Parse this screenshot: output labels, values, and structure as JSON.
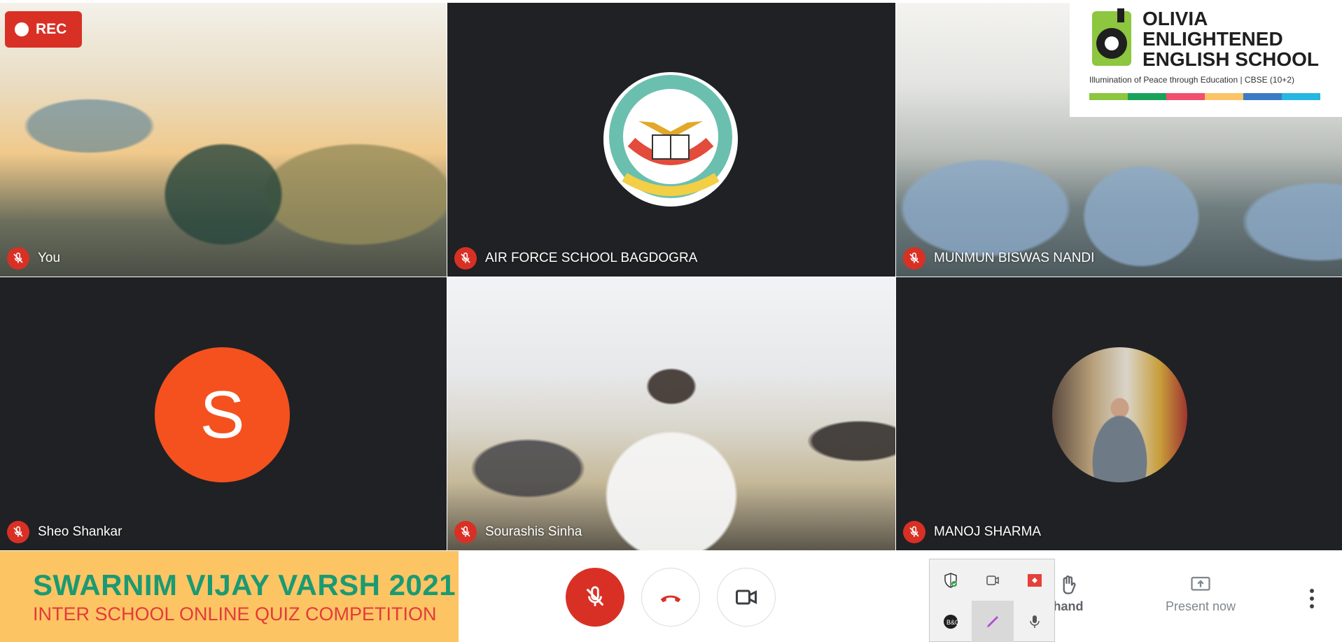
{
  "recording": {
    "label": "REC"
  },
  "participants": [
    {
      "name": "You"
    },
    {
      "name": "AIR FORCE SCHOOL BAGDOGRA"
    },
    {
      "name": "MUNMUN BISWAS NANDI"
    },
    {
      "name": "Sheo Shankar",
      "initial": "S"
    },
    {
      "name": "Sourashis Sinha"
    },
    {
      "name": "MANOJ SHARMA"
    }
  ],
  "brand": {
    "line1": "OLIVIA",
    "line2": "ENLIGHTENED",
    "line3": "ENGLISH SCHOOL",
    "tagline": "Illumination of Peace through Education | CBSE (10+2)",
    "stripe_colors": [
      "#8dc63f",
      "#1aa15a",
      "#f0506e",
      "#fbc468",
      "#3a7cc4",
      "#26b7e0"
    ]
  },
  "banner": {
    "title": "SWARNIM VIJAY VARSH 2021",
    "subtitle": "INTER SCHOOL ONLINE QUIZ COMPETITION"
  },
  "controls": {
    "raise_hand_label": "hand",
    "present_label": "Present now"
  },
  "colors": {
    "mute_red": "#d93025",
    "tile_bg": "#202124",
    "avatar_orange": "#f4511e"
  }
}
